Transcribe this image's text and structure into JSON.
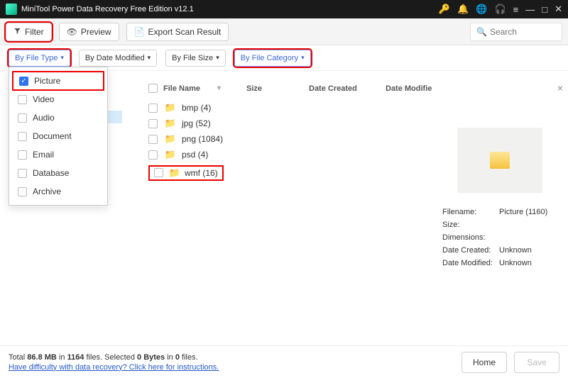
{
  "title": "MiniTool Power Data Recovery Free Edition v12.1",
  "toolbar": {
    "filter": "Filter",
    "preview": "Preview",
    "export": "Export Scan Result",
    "search_placeholder": "Search"
  },
  "filters": {
    "by_type": "By File Type",
    "by_date": "By Date Modified",
    "by_size": "By File Size",
    "by_category": "By File Category"
  },
  "type_menu": [
    {
      "label": "Picture",
      "checked": true
    },
    {
      "label": "Video",
      "checked": false
    },
    {
      "label": "Audio",
      "checked": false
    },
    {
      "label": "Document",
      "checked": false
    },
    {
      "label": "Email",
      "checked": false
    },
    {
      "label": "Database",
      "checked": false
    },
    {
      "label": "Archive",
      "checked": false
    }
  ],
  "columns": {
    "name": "File Name",
    "size": "Size",
    "created": "Date Created",
    "modified": "Date Modifie"
  },
  "files": [
    {
      "label": "bmp (4)"
    },
    {
      "label": "jpg (52)"
    },
    {
      "label": "png (1084)"
    },
    {
      "label": "psd (4)"
    },
    {
      "label": "wmf (16)"
    }
  ],
  "preview": {
    "filename_lbl": "Filename:",
    "filename_val": "Picture (1160)",
    "size_lbl": "Size:",
    "dimensions_lbl": "Dimensions:",
    "created_lbl": "Date Created:",
    "created_val": "Unknown",
    "modified_lbl": "Date Modified:",
    "modified_val": "Unknown"
  },
  "status": {
    "line1_a": "Total ",
    "line1_b": "86.8 MB",
    "line1_c": " in ",
    "line1_d": "1164",
    "line1_e": " files.    Selected ",
    "line1_f": "0 Bytes",
    "line1_g": " in ",
    "line1_h": "0",
    "line1_i": " files.",
    "help_link": "Have difficulty with data recovery? Click here for instructions.",
    "home": "Home",
    "save": "Save"
  }
}
